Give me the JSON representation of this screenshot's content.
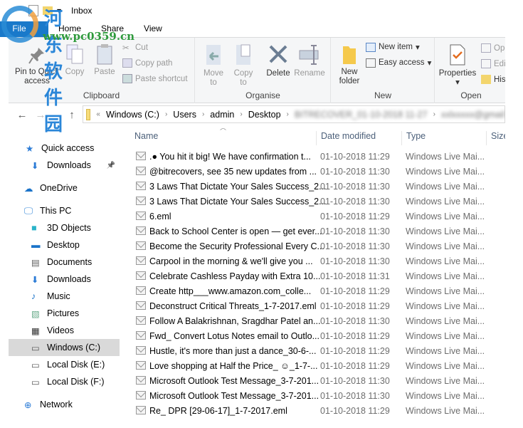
{
  "window": {
    "title": "Inbox"
  },
  "watermark": {
    "text": "河东软件园",
    "url": "www.pc0359.cn"
  },
  "tabs": [
    "File",
    "Home",
    "Share",
    "View"
  ],
  "ribbon": {
    "clipboard": {
      "label": "Clipboard",
      "pin": "Pin to Quick access",
      "copy": "Copy",
      "paste": "Paste",
      "cut": "Cut",
      "copy_path": "Copy path",
      "paste_shortcut": "Paste shortcut"
    },
    "organise": {
      "label": "Organise",
      "move_to": "Move to",
      "copy_to": "Copy to",
      "delete": "Delete",
      "rename": "Rename"
    },
    "new": {
      "label": "New",
      "new_folder": "New folder",
      "new_item": "New item",
      "easy_access": "Easy access"
    },
    "open": {
      "label": "Open",
      "properties": "Properties",
      "open": "Op",
      "edit": "Edi",
      "history": "His"
    }
  },
  "address": {
    "crumbs": [
      "Windows (C:)",
      "Users",
      "admin",
      "Desktop",
      "BITRECOVER_01-10-2018 11-27",
      "xxlxxxxx@gmail"
    ]
  },
  "sidebar": [
    {
      "label": "Quick access",
      "icon": "star-icon"
    },
    {
      "label": "Downloads",
      "icon": "download-icon",
      "pinned": true
    },
    {
      "label": "OneDrive",
      "icon": "cloud-icon"
    },
    {
      "label": "This PC",
      "icon": "computer-icon"
    },
    {
      "label": "3D Objects",
      "icon": "cube-icon"
    },
    {
      "label": "Desktop",
      "icon": "desktop-icon"
    },
    {
      "label": "Documents",
      "icon": "document-icon"
    },
    {
      "label": "Downloads",
      "icon": "download-icon"
    },
    {
      "label": "Music",
      "icon": "music-icon"
    },
    {
      "label": "Pictures",
      "icon": "picture-icon"
    },
    {
      "label": "Videos",
      "icon": "video-icon"
    },
    {
      "label": "Windows (C:)",
      "icon": "drive-icon",
      "selected": true
    },
    {
      "label": "Local Disk (E:)",
      "icon": "drive-icon"
    },
    {
      "label": "Local Disk (F:)",
      "icon": "drive-icon"
    },
    {
      "label": "Network",
      "icon": "network-icon"
    }
  ],
  "columns": [
    "Name",
    "Date modified",
    "Type",
    "Size"
  ],
  "files": [
    {
      "name": ".● You hit it big! We have confirmation t...",
      "date": "01-10-2018 11:29",
      "type": "Windows Live Mai..."
    },
    {
      "name": "@bitrecovers, see 35 new updates from ...",
      "date": "01-10-2018 11:30",
      "type": "Windows Live Mai..."
    },
    {
      "name": "3 Laws That Dictate Your Sales Success_2...",
      "date": "01-10-2018 11:30",
      "type": "Windows Live Mai..."
    },
    {
      "name": "3 Laws That Dictate Your Sales Success_2...",
      "date": "01-10-2018 11:30",
      "type": "Windows Live Mai..."
    },
    {
      "name": "6.eml",
      "date": "01-10-2018 11:29",
      "type": "Windows Live Mai..."
    },
    {
      "name": "Back to School Center is open — get ever...",
      "date": "01-10-2018 11:30",
      "type": "Windows Live Mai..."
    },
    {
      "name": "Become the Security Professional Every C...",
      "date": "01-10-2018 11:30",
      "type": "Windows Live Mai..."
    },
    {
      "name": "Carpool in the morning & we'll give you ...",
      "date": "01-10-2018 11:30",
      "type": "Windows Live Mai..."
    },
    {
      "name": "Celebrate Cashless Payday with Extra 10...",
      "date": "01-10-2018 11:31",
      "type": "Windows Live Mai..."
    },
    {
      "name": "Create http___www.amazon.com_colle...",
      "date": "01-10-2018 11:29",
      "type": "Windows Live Mai..."
    },
    {
      "name": "Deconstruct Critical Threats_1-7-2017.eml",
      "date": "01-10-2018 11:29",
      "type": "Windows Live Mai..."
    },
    {
      "name": "Follow A Balakrishnan, Sragdhar Patel an...",
      "date": "01-10-2018 11:30",
      "type": "Windows Live Mai..."
    },
    {
      "name": "Fwd_ Convert Lotus Notes email to Outlo...",
      "date": "01-10-2018 11:29",
      "type": "Windows Live Mai..."
    },
    {
      "name": "Hustle, it's more than just a dance_30-6-...",
      "date": "01-10-2018 11:29",
      "type": "Windows Live Mai..."
    },
    {
      "name": "Love shopping at Half the Price_ ☺_1-7-...",
      "date": "01-10-2018 11:29",
      "type": "Windows Live Mai..."
    },
    {
      "name": "Microsoft Outlook Test Message_3-7-201...",
      "date": "01-10-2018 11:30",
      "type": "Windows Live Mai..."
    },
    {
      "name": "Microsoft Outlook Test Message_3-7-201...",
      "date": "01-10-2018 11:30",
      "type": "Windows Live Mai..."
    },
    {
      "name": "Re_ DPR [29-06-17]_1-7-2017.eml",
      "date": "01-10-2018 11:29",
      "type": "Windows Live Mai..."
    }
  ]
}
